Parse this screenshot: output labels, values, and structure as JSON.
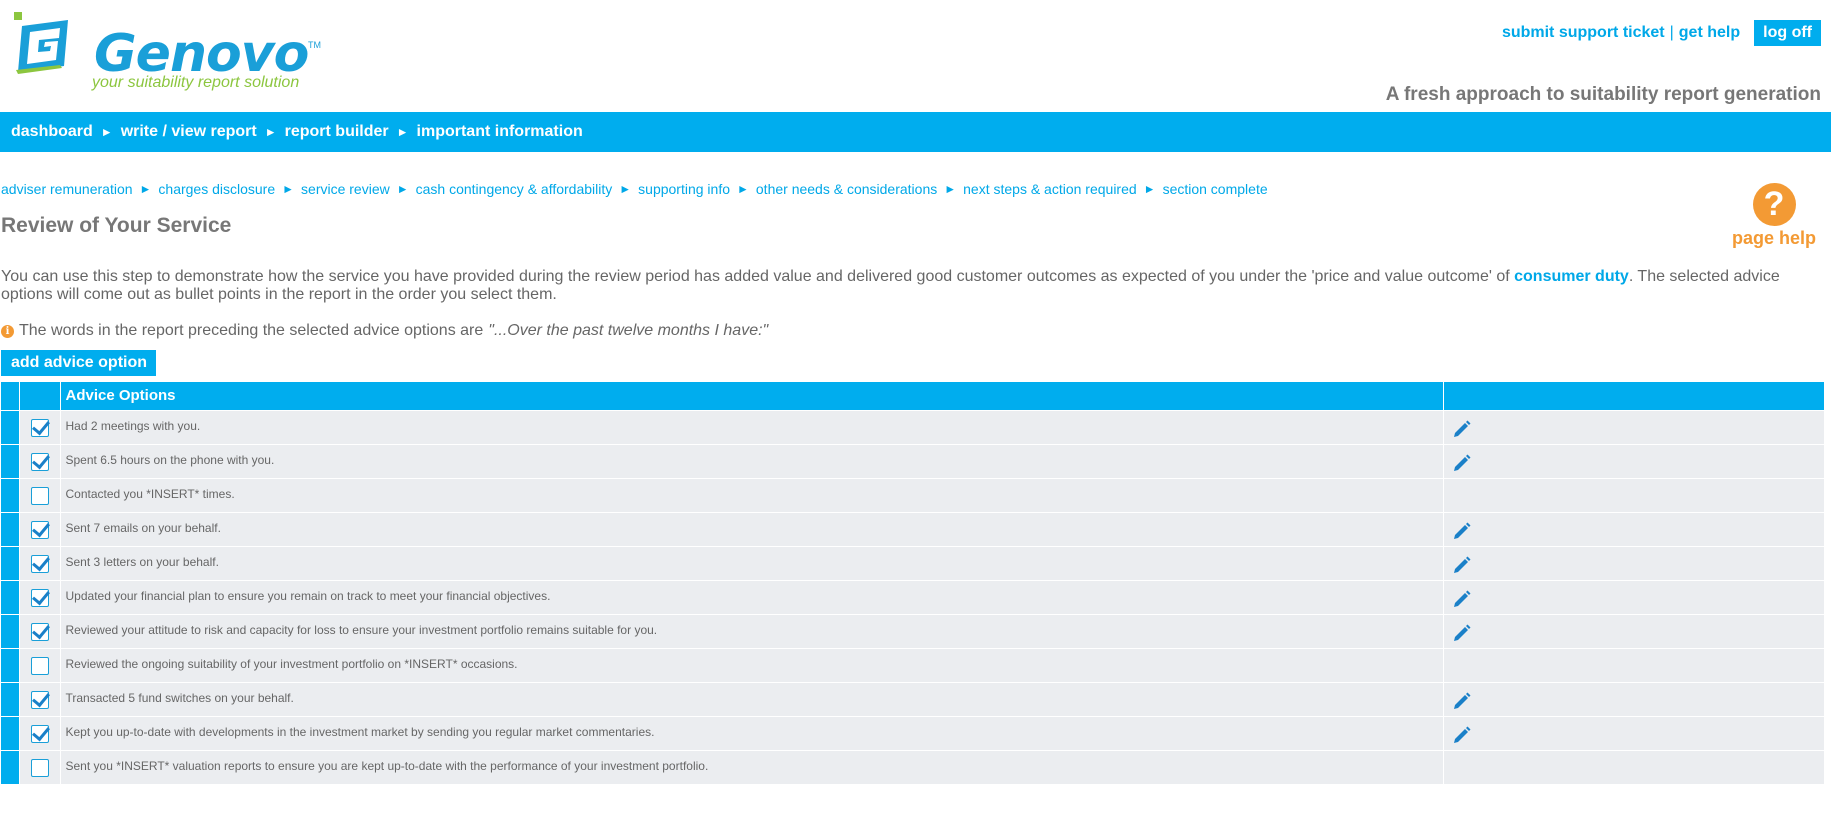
{
  "brand": {
    "name": "Genovo",
    "tm": "TM",
    "tagline": "your suitability report solution",
    "slogan": "A fresh approach to suitability report generation"
  },
  "toplinks": {
    "support": "submit support ticket",
    "separator": "|",
    "help": "get help",
    "logoff": "log off"
  },
  "mainnav": {
    "arrow": "►",
    "items": [
      "dashboard",
      "write / view report",
      "report builder",
      "important information"
    ]
  },
  "subnav": {
    "arrow": "►",
    "items": [
      "adviser remuneration",
      "charges disclosure",
      "service review",
      "cash contingency & affordability",
      "supporting info",
      "other needs & considerations",
      "next steps & action required",
      "section complete"
    ]
  },
  "pagehelp": {
    "icon": "?",
    "label": "page help"
  },
  "page": {
    "title": "Review of Your Service",
    "intro_before": "You can use this step to demonstrate how the service you have provided during the review period has added value and delivered good customer outcomes as expected of you under the 'price and value outcome' of ",
    "intro_link": "consumer duty",
    "intro_after": ". The selected advice options will come out as bullet points in the report in the order you select them.",
    "note_icon": "i",
    "note_text": "The words in the report preceding the selected advice options are",
    "note_quote": "\"...Over the past twelve months I have:\"",
    "add_button": "add advice option"
  },
  "table": {
    "header": "Advice Options",
    "rows": [
      {
        "text": "Had 2 meetings with you.",
        "checked": true
      },
      {
        "text": "Spent 6.5 hours on the phone with you.",
        "checked": true
      },
      {
        "text": "Contacted you *INSERT* times.",
        "checked": false
      },
      {
        "text": "Sent 7 emails on your behalf.",
        "checked": true
      },
      {
        "text": "Sent 3 letters on your behalf.",
        "checked": true
      },
      {
        "text": "Updated your financial plan to ensure you remain on track to meet your financial objectives.",
        "checked": true
      },
      {
        "text": "Reviewed your attitude to risk and capacity for loss to ensure your investment portfolio remains suitable for you.",
        "checked": true
      },
      {
        "text": "Reviewed the ongoing suitability of your investment portfolio on *INSERT* occasions.",
        "checked": false
      },
      {
        "text": "Transacted 5 fund switches on your behalf.",
        "checked": true
      },
      {
        "text": "Kept you up-to-date with developments in the investment market by sending you regular market commentaries.",
        "checked": true
      },
      {
        "text": "Sent you *INSERT* valuation reports to ensure you are kept up-to-date with the performance of your investment portfolio.",
        "checked": false
      }
    ]
  },
  "colors": {
    "primary": "#00adee",
    "link": "#00a8e8",
    "accent_orange": "#f39a34",
    "tagline_green": "#8cc63f",
    "row_bg": "#ebedf0"
  }
}
